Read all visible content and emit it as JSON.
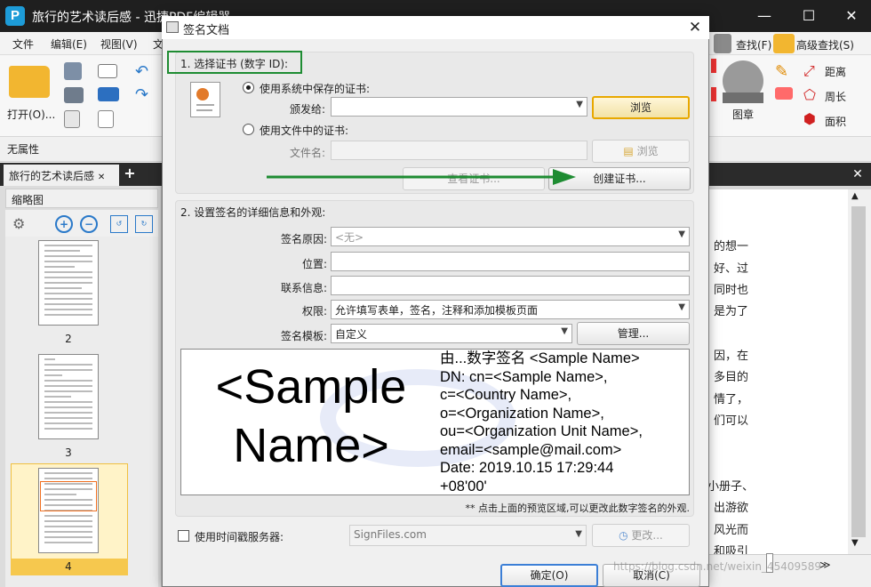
{
  "app": {
    "title": "旅行的艺术读后感 - 迅捷PDF编辑器",
    "logo": "P",
    "menu": [
      "文件",
      "编辑(E)",
      "视图(V)",
      "文"
    ],
    "ribbon": {
      "open_label": "打开(O)...",
      "find_label": "查找(F)",
      "adv_find_label": "高级查找(S)",
      "stamp_label": "图章",
      "distance_label": "距离",
      "perimeter_label": "周长",
      "area_label": "面积"
    },
    "properties_label": "无属性",
    "doc_tab": "旅行的艺术读后感",
    "thumbnails": {
      "header": "缩略图",
      "pages": [
        "2",
        "3",
        "4"
      ]
    },
    "doc_lines": [
      "的想一",
      "好、过",
      "同时也",
      "是为了",
      "因，在",
      "多目的",
      "情了，",
      "们可以",
      "小册子、",
      "出游欲",
      "风光而",
      "和吸引"
    ]
  },
  "dialog": {
    "title": "签名文档",
    "close": "✕",
    "section1": {
      "title": "1. 选择证书 (数字 ID):",
      "radio_system": "使用系统中保存的证书:",
      "issued_to_label": "颁发给:",
      "issued_to_value": "",
      "browse1": "浏览",
      "radio_file": "使用文件中的证书:",
      "filename_label": "文件名:",
      "filename_value": "",
      "browse2": "浏览",
      "view_cert": "查看证书...",
      "create_cert": "创建证书..."
    },
    "section2": {
      "title": "2. 设置签名的详细信息和外观:",
      "reason_label": "签名原因:",
      "reason_value": "<无>",
      "location_label": "位置:",
      "location_value": "",
      "contact_label": "联系信息:",
      "contact_value": "",
      "permission_label": "权限:",
      "permission_value": "允许填写表单，签名，注释和添加模板页面",
      "template_label": "签名模板:",
      "template_value": "自定义",
      "manage": "管理...",
      "preview_name": "<Sample\nName>",
      "preview_details": "由...数字签名 <Sample Name>\nDN: cn=<Sample Name>,\nc=<Country Name>,\no=<Organization Name>,\nou=<Organization Unit Name>,\nemail=<sample@mail.com>\nDate: 2019.10.15 17:29:44\n+08'00'",
      "preview_hint": "** 点击上面的预览区域,可以更改此数字签名的外观."
    },
    "timestamp": {
      "label": "使用时间戳服务器:",
      "server": "SignFiles.com",
      "change": "更改..."
    },
    "ok": "确定(O)",
    "cancel": "取消(C)"
  },
  "watermark": "https://blog.csdn.net/weixin_45409589",
  "colors": {
    "accent_green": "#1e8c32",
    "focus_border": "#e8a800",
    "title_bar": "#1f1f1f"
  }
}
